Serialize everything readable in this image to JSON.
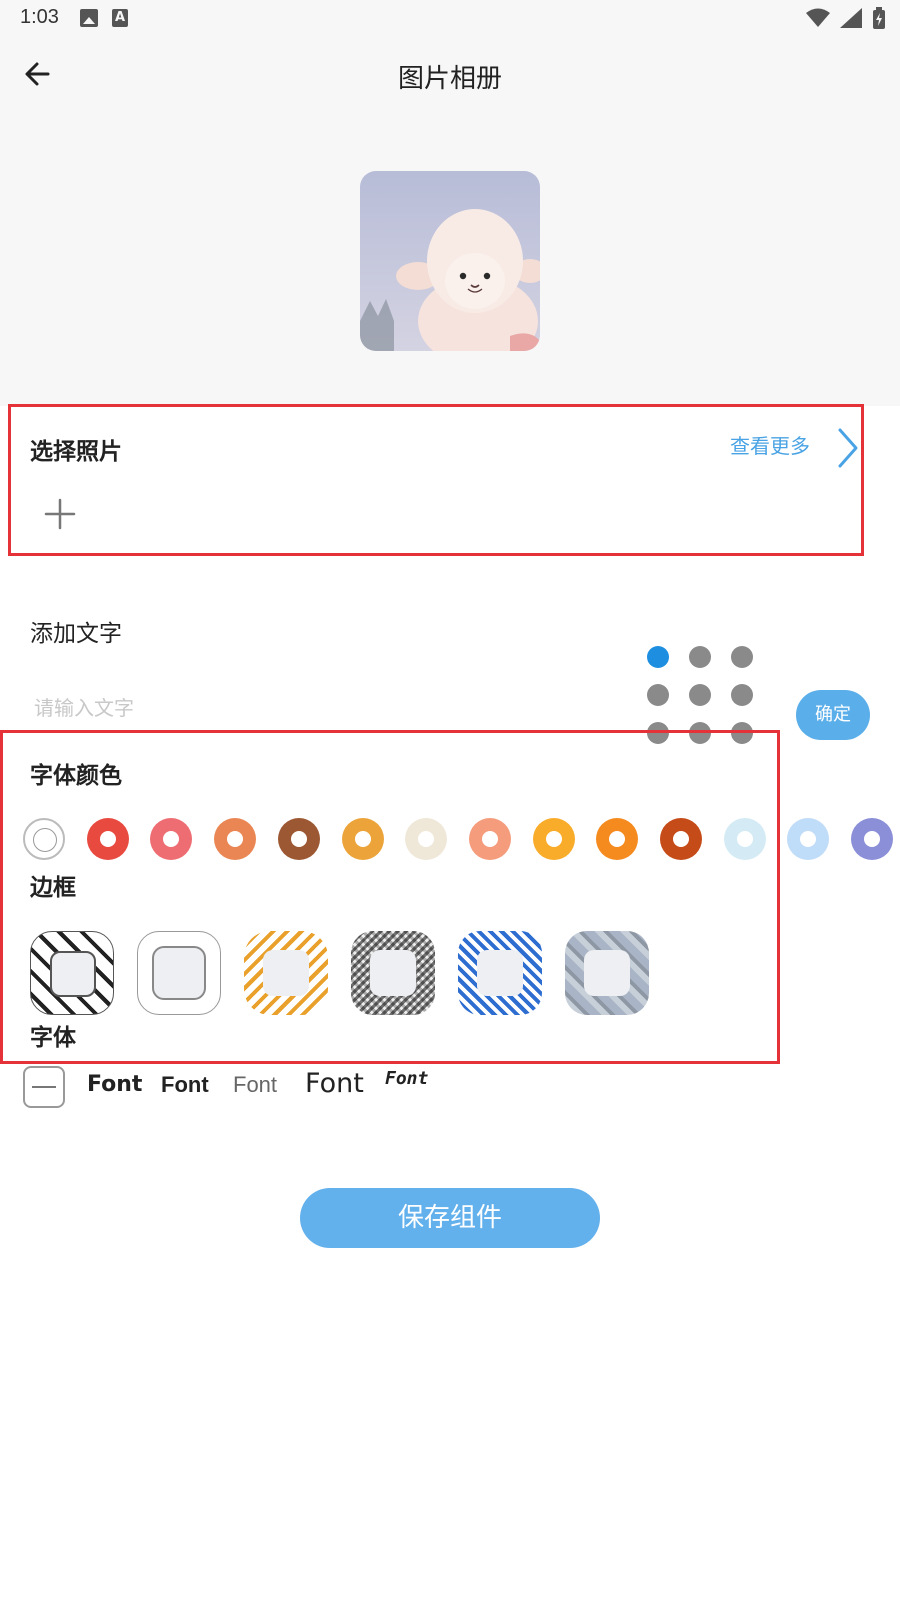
{
  "status_bar": {
    "time": "1:03",
    "left_icons": [
      "image-icon",
      "font-a-icon"
    ],
    "right_icons": [
      "wifi-icon",
      "signal-icon",
      "battery-icon"
    ]
  },
  "header": {
    "title": "图片相册",
    "back_icon": "arrow-left-icon",
    "preview_image": "plush-lamb-photo"
  },
  "photo_section": {
    "title": "选择照片",
    "view_more": "查看更多",
    "chevron_icon": "chevron-right-icon",
    "add_icon": "plus-icon"
  },
  "text_section": {
    "title": "添加文字",
    "input_value": "",
    "input_placeholder": "请输入文字",
    "alignment_selected_index": 0,
    "confirm_label": "确定"
  },
  "font_color_section": {
    "title": "字体颜色",
    "swatches": [
      {
        "name": "none",
        "color": "#ffffff"
      },
      {
        "name": "red",
        "color": "#e84a3f"
      },
      {
        "name": "pink-red",
        "color": "#ee6d72"
      },
      {
        "name": "orange-peach",
        "color": "#ea8654"
      },
      {
        "name": "brown",
        "color": "#9c5733"
      },
      {
        "name": "amber",
        "color": "#eca43a"
      },
      {
        "name": "cream",
        "color": "#efe8d9"
      },
      {
        "name": "salmon",
        "color": "#f59c7c"
      },
      {
        "name": "yellow-orange",
        "color": "#f9ac2a"
      },
      {
        "name": "orange",
        "color": "#f58a1e"
      },
      {
        "name": "rust",
        "color": "#c54b18"
      },
      {
        "name": "pale-blue",
        "color": "#d4ebf5"
      },
      {
        "name": "light-blue",
        "color": "#bfdcf8"
      },
      {
        "name": "lavender",
        "color": "#8b8fd8"
      }
    ]
  },
  "border_section": {
    "title": "边框",
    "frames": [
      "black-diagonal-stripes",
      "plain-outline",
      "orange-diagonal-stripes",
      "gray-plaid",
      "blue-gingham",
      "gray-blue-pattern"
    ]
  },
  "font_section": {
    "title": "字体",
    "options": [
      "Font",
      "Font",
      "Font",
      "Font",
      "Font"
    ]
  },
  "save_label": "保存组件",
  "colors": {
    "accent": "#4aa3e4",
    "button_blue": "#62b0ec",
    "highlight_red": "#e53238",
    "active_dot": "#1e8fe0"
  }
}
